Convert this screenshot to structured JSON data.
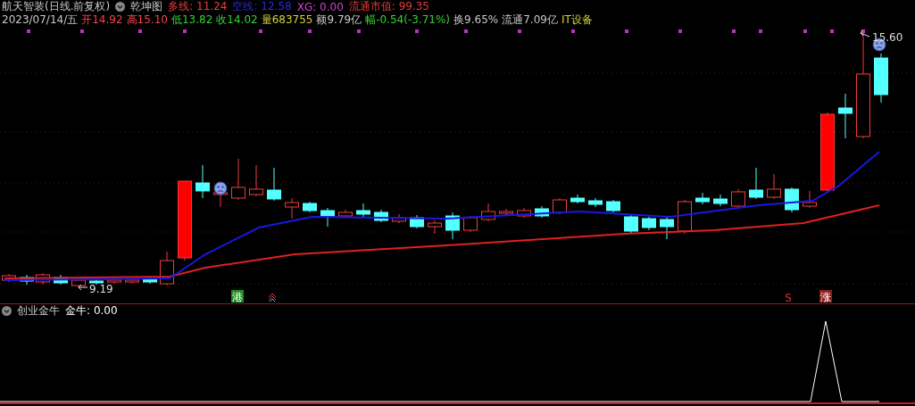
{
  "header": {
    "name": "航天智装",
    "mode": "(日线.前复权)",
    "indicator": "乾坤图",
    "indicators": [
      {
        "label": "多线:",
        "value": "11.24",
        "color": "#f03c3c"
      },
      {
        "label": "空线:",
        "value": "12.58",
        "color": "#2828e0"
      },
      {
        "label": "XG:",
        "value": "0.00",
        "color": "#d040d0"
      },
      {
        "label": "流通市值:",
        "value": "99.35",
        "color": "#e03c3c"
      }
    ]
  },
  "quote": {
    "date": "2023/07/14/五",
    "fields": [
      {
        "label": "开",
        "value": "14.92",
        "color": "#f04848"
      },
      {
        "label": "高",
        "value": "15.10",
        "color": "#f04848"
      },
      {
        "label": "低",
        "value": "13.82",
        "color": "#38d038"
      },
      {
        "label": "收",
        "value": "14.02",
        "color": "#38d038"
      },
      {
        "label": "量",
        "value": "683755",
        "color": "#d0d040"
      },
      {
        "label": "额",
        "value": "9.79亿",
        "color": "#c8c8c8"
      },
      {
        "label": "幅",
        "value": "-0.54(-3.71%)",
        "color": "#38d038"
      },
      {
        "label": "换",
        "value": "9.65%",
        "color": "#c8c8c8"
      },
      {
        "label": "流通",
        "value": "7.09亿",
        "color": "#c8c8c8"
      },
      {
        "value": "IT设备",
        "color": "#d0d040"
      }
    ]
  },
  "chart": {
    "high_label": "15.60",
    "low_label": "9.19",
    "markers": [
      {
        "text": "港",
        "kind": "badge",
        "color": "#1e8c1e"
      },
      {
        "text": "S",
        "kind": "plain",
        "color": "#e03030"
      },
      {
        "text": "涨",
        "kind": "badge",
        "color": "#8c1e1e"
      }
    ]
  },
  "lower_panel": {
    "name": "创业金牛",
    "values": [
      {
        "label": "金牛:",
        "value": "0.00"
      }
    ]
  }
}
